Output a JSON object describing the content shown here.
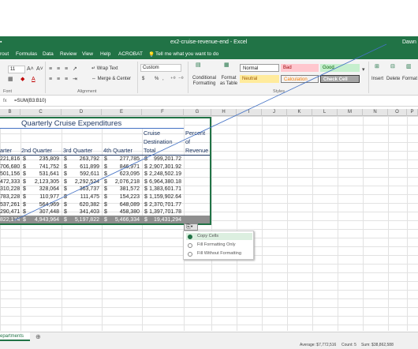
{
  "window": {
    "title": "ex2-cruise-revenue-end  -  Excel",
    "user": "Dawn"
  },
  "tabs": [
    "rout",
    "Formulas",
    "Data",
    "Review",
    "View",
    "Help",
    "ACROBAT"
  ],
  "tell_me": "Tell me what you want to do",
  "ribbon": {
    "font_size": "11",
    "wrap_text": "Wrap Text",
    "merge_center": "Merge & Center",
    "number_format": "Custom",
    "currency_symbols": [
      "$",
      "%",
      ","
    ],
    "conditional_formatting": "Conditional Formatting",
    "format_as_table": "Format as Table",
    "groups": {
      "font": "Font",
      "alignment": "Alignment",
      "number": "Number",
      "styles": "Styles"
    },
    "styles": {
      "normal": "Normal",
      "bad": "Bad",
      "good": "Good",
      "neutral": "Neutral",
      "calculation": "Calculation",
      "check_cell": "Check Cell"
    },
    "cells": {
      "insert": "Insert",
      "delete": "Delete",
      "format": "Format"
    }
  },
  "formula_bar": {
    "formula": "=SUM(B3:B10)"
  },
  "columns": [
    "B",
    "C",
    "D",
    "E",
    "F",
    "G",
    "H",
    "I",
    "J",
    "K",
    "L",
    "M",
    "N",
    "O",
    "P"
  ],
  "sheet": {
    "title": "Quarterly Cruise Expenditures",
    "headers": {
      "q1": "arter",
      "q2": "2nd Quarter",
      "q3": "3rd Quarter",
      "q4": "4th Quarter",
      "total": [
        "Cruise",
        "Destination",
        "Total"
      ],
      "pct": [
        "Percent",
        "of",
        "Revenue"
      ]
    },
    "rows": [
      {
        "b": "221,816",
        "c": "235,809",
        "d": "263,792",
        "e": "277,785",
        "f": "999,201.72"
      },
      {
        "b": "706,680",
        "c": "741,752",
        "d": "611,899",
        "e": "846,971",
        "f": "2,907,301.92"
      },
      {
        "b": "501,156",
        "c": "531,641",
        "d": "592,611",
        "e": "623,095",
        "f": "2,248,502.19"
      },
      {
        "b": "472,333",
        "c": "2,123,305",
        "d": "2,292,524",
        "e": "2,076,218",
        "f": "6,964,380.18"
      },
      {
        "b": "310,228",
        "c": "328,064",
        "d": "363,737",
        "e": "381,572",
        "f": "1,383,601.71"
      },
      {
        "b": "783,228",
        "c": "110,977",
        "d": "111,475",
        "e": "154,223",
        "f": "1,159,902.64"
      },
      {
        "b": "537,261",
        "c": "564,969",
        "d": "620,382",
        "e": "648,089",
        "f": "2,370,701.77"
      },
      {
        "b": "290,471",
        "c": "307,448",
        "d": "341,403",
        "e": "458,380",
        "f": "1,397,701.78"
      }
    ],
    "total": {
      "b": "822,174",
      "c": "4,943,964",
      "d": "5,197,822",
      "e": "5,466,334",
      "f": "19,431,294"
    },
    "currency": "$"
  },
  "paste_options": [
    "Copy Cells",
    "Fill Formatting Only",
    "Fill Without Formatting"
  ],
  "sheet_tab": "epartments",
  "status": {
    "average": "Average: $7,772,516",
    "count": "Count: 5",
    "sum": "Sum: $38,862,588"
  },
  "colors": {
    "excel_green": "#217346",
    "total_row": "#8f8f8f",
    "header_text": "#1f3864",
    "connector_line": "#4472c4"
  }
}
